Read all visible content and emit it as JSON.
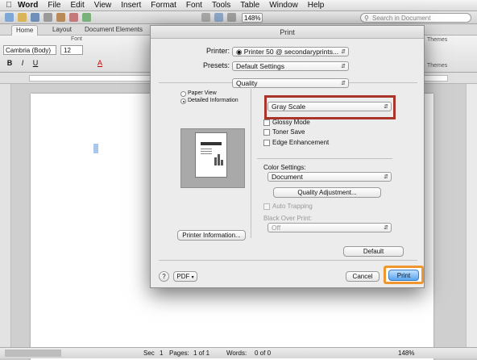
{
  "menubar": {
    "app": "Word",
    "items": [
      "File",
      "Edit",
      "View",
      "Insert",
      "Format",
      "Font",
      "Tools",
      "Table",
      "Window",
      "Help"
    ]
  },
  "toolbar": {
    "zoom": "148%",
    "search_placeholder": "Search in Document"
  },
  "ribbon": {
    "tabs": [
      "Home",
      "Layout",
      "Document Elements"
    ],
    "font_group_label": "Font",
    "font_name": "Cambria (Body)",
    "font_size": "12",
    "themes_label": "Themes"
  },
  "print_dialog": {
    "title": "Print",
    "printer_label": "Printer:",
    "printer_value": "Printer 50 @ secondaryprints...",
    "presets_label": "Presets:",
    "presets_value": "Default Settings",
    "panel_value": "Quality",
    "preview_options": [
      {
        "label": "Paper View",
        "selected": false
      },
      {
        "label": "Detailed Information",
        "selected": true
      }
    ],
    "printer_info_button": "Printer Information...",
    "gray_scale_value": "Gray Scale",
    "checkboxes": [
      {
        "label": "Glossy Mode",
        "checked": false
      },
      {
        "label": "Toner Save",
        "checked": false
      },
      {
        "label": "Edge Enhancement",
        "checked": false
      }
    ],
    "color_settings_label": "Color Settings:",
    "color_settings_value": "Document",
    "quality_adjustment_button": "Quality Adjustment...",
    "auto_trapping_label": "Auto Trapping",
    "black_over_print_label": "Black Over Print:",
    "black_over_print_value": "Off",
    "default_button": "Default",
    "help_button": "?",
    "pdf_button": "PDF",
    "cancel_button": "Cancel",
    "print_button": "Print"
  },
  "statusbar": {
    "sec_label": "Sec",
    "sec_value": "1",
    "pages_label": "Pages:",
    "pages_value": "1 of 1",
    "words_label": "Words:",
    "words_value": "0 of 0",
    "zoom": "148%"
  },
  "colors": {
    "highlight_red": "#a8342a",
    "highlight_orange": "#f0962f",
    "print_button_blue": "#5aa5ec"
  }
}
